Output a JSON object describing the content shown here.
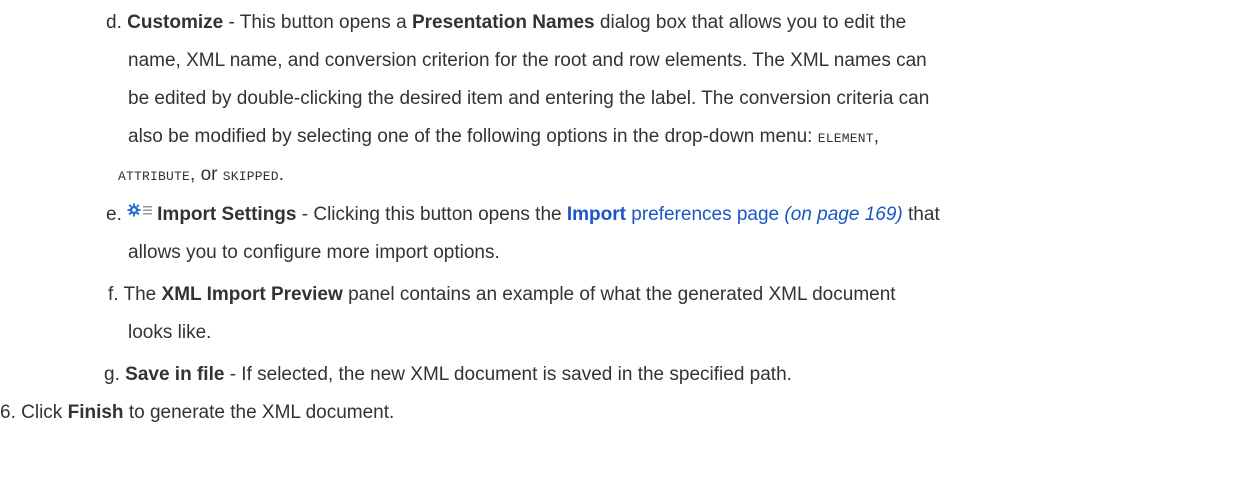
{
  "items": {
    "d": {
      "marker": "d.",
      "title": "Customize",
      "text1": " - This button opens a ",
      "dialog_name": "Presentation Names",
      "text2": " dialog box that allows you to edit the",
      "line2": "name, XML name, and conversion criterion for the root and row elements. The XML names can",
      "line3": "be edited by double-clicking the desired item and entering the label. The conversion criteria can",
      "line4": "also be modified by selecting one of the following options in the drop-down menu: ",
      "opt_element": "ELEMENT",
      "comma1": ",",
      "opt_attribute": "ATTRIBUTE",
      "or_text": ", or ",
      "opt_skipped": "SKIPPED",
      "period": "."
    },
    "e": {
      "marker": "e.",
      "icon": "settings-icon",
      "title": "Import Settings",
      "text1": " - Clicking this button opens the ",
      "link_bold": "Import",
      "link_rest": " preferences page",
      "page_ref": "(on page 169)",
      "text2": " that",
      "line2": "allows you to configure more import options."
    },
    "f": {
      "marker": "f.",
      "text1": "The ",
      "panel_name": "XML Import Preview",
      "text2": " panel contains an example of what the generated XML document",
      "line2": "looks like."
    },
    "g": {
      "marker": "g.",
      "title": "Save in file",
      "text1": " - If selected, the new XML document is saved in the specified path."
    }
  },
  "step6": {
    "marker": "6.",
    "text1": "Click ",
    "action": "Finish",
    "text2": " to generate the XML document."
  },
  "colors": {
    "text": "#333333",
    "link": "#1a56c4",
    "icon_blue": "#2a6fd1",
    "icon_gray": "#8a9bb0"
  }
}
